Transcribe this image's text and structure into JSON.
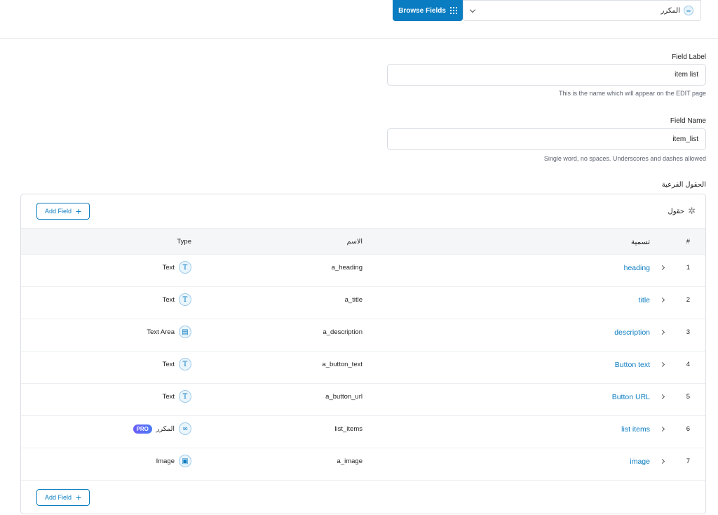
{
  "topbar": {
    "browse_label": "Browse Fields",
    "field_type": "المكرر"
  },
  "field_label": {
    "label": "Field Label",
    "value": "item list",
    "help": "This is the name which will appear on the EDIT page"
  },
  "field_name": {
    "label": "Field Name",
    "value": "item_list",
    "help": "Single word, no spaces. Underscores and dashes allowed"
  },
  "subfields": {
    "label": "الحقول الفرعية",
    "title": "حقول",
    "add_label": "Add Field",
    "headers": {
      "num": "#",
      "label": "تسمية",
      "name": "الاسم",
      "type": "Type"
    },
    "rows": [
      {
        "num": "1",
        "label": "heading",
        "name": "a_heading",
        "type": "Text",
        "icon": "T"
      },
      {
        "num": "2",
        "label": "title",
        "name": "a_title",
        "type": "Text",
        "icon": "T"
      },
      {
        "num": "3",
        "label": "description",
        "name": "a_description",
        "type": "Text Area",
        "icon": "▤"
      },
      {
        "num": "4",
        "label": "Button text",
        "name": "a_button_text",
        "type": "Text",
        "icon": "T"
      },
      {
        "num": "5",
        "label": "Button URL",
        "name": "a_button_url",
        "type": "Text",
        "icon": "T"
      },
      {
        "num": "6",
        "label": "list items",
        "name": "list_items",
        "type": "المكرر",
        "icon": "∞",
        "badge": "PRO"
      },
      {
        "num": "7",
        "label": "image",
        "name": "a_image",
        "type": "Image",
        "icon": "▣"
      }
    ]
  }
}
